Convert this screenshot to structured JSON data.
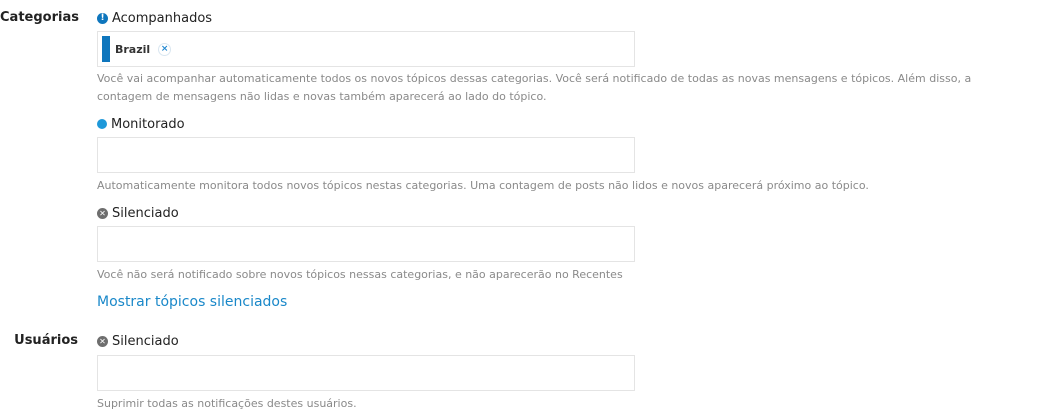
{
  "categories": {
    "section_label": "Categorias",
    "tracking": {
      "label": "Acompanhados",
      "icon": "info-circle-icon",
      "chips": [
        {
          "name": "Brazil",
          "color": "#0e76bd"
        }
      ],
      "remove_symbol": "×",
      "help": "Você vai acompanhar automaticamente todos os novos tópicos dessas categorias. Você será notificado de todas as novas mensagens e tópicos. Além disso, a contagem de mensagens não lidas e novas também aparecerá ao lado do tópico."
    },
    "watching": {
      "label": "Monitorado",
      "icon": "dot-circle-icon",
      "help": "Automaticamente monitora todos novos tópicos nestas categorias. Uma contagem de posts não lidos e novos aparecerá próximo ao tópico."
    },
    "muted": {
      "label": "Silenciado",
      "icon": "times-circle-icon",
      "help": "Você não será notificado sobre novos tópicos nessas categorias, e não aparecerão no Recentes"
    },
    "show_muted_link": "Mostrar tópicos silenciados"
  },
  "users": {
    "section_label": "Usuários",
    "muted": {
      "label": "Silenciado",
      "icon": "times-circle-icon",
      "help": "Suprimir todas as notificações destes usuários."
    }
  },
  "colors": {
    "accent": "#0e76bd",
    "link": "#1a88c9",
    "help_text": "#8a8a8a"
  }
}
